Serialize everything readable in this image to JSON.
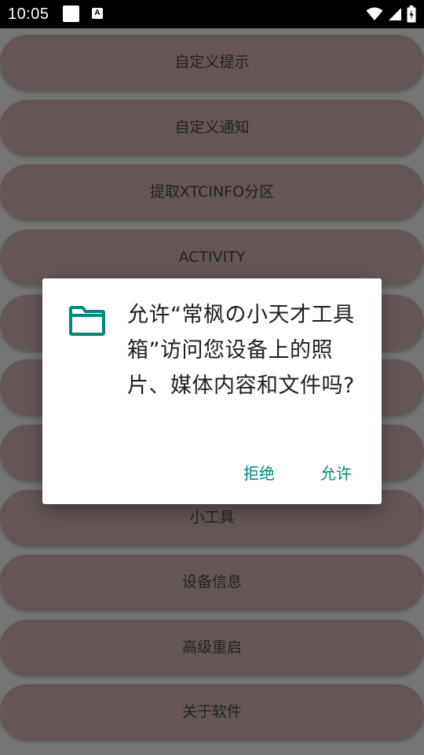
{
  "status_bar": {
    "time": "10:05",
    "notification_icons": [
      "blank-square-icon",
      "font-a-icon"
    ],
    "system_icons": [
      "wifi-icon",
      "cellular-signal-icon",
      "battery-charging-icon"
    ]
  },
  "menu": {
    "items": [
      {
        "label": "自定义提示"
      },
      {
        "label": "自定义通知"
      },
      {
        "label": "提取XTCINFO分区"
      },
      {
        "label": "ACTIVITY"
      },
      {
        "label": ""
      },
      {
        "label": ""
      },
      {
        "label": ""
      },
      {
        "label": "小工具"
      },
      {
        "label": "设备信息"
      },
      {
        "label": "高级重启"
      },
      {
        "label": "关于软件"
      }
    ]
  },
  "dialog": {
    "icon": "folder-icon",
    "message": "允许“常枫の小天才工具箱”访问您设备上的照片、媒体内容和文件吗?",
    "deny_label": "拒绝",
    "allow_label": "允许"
  },
  "colors": {
    "accent": "#00897b",
    "menu_button_bg": "#645656",
    "scrim": "#747474",
    "status_bar_bg": "#000000"
  }
}
